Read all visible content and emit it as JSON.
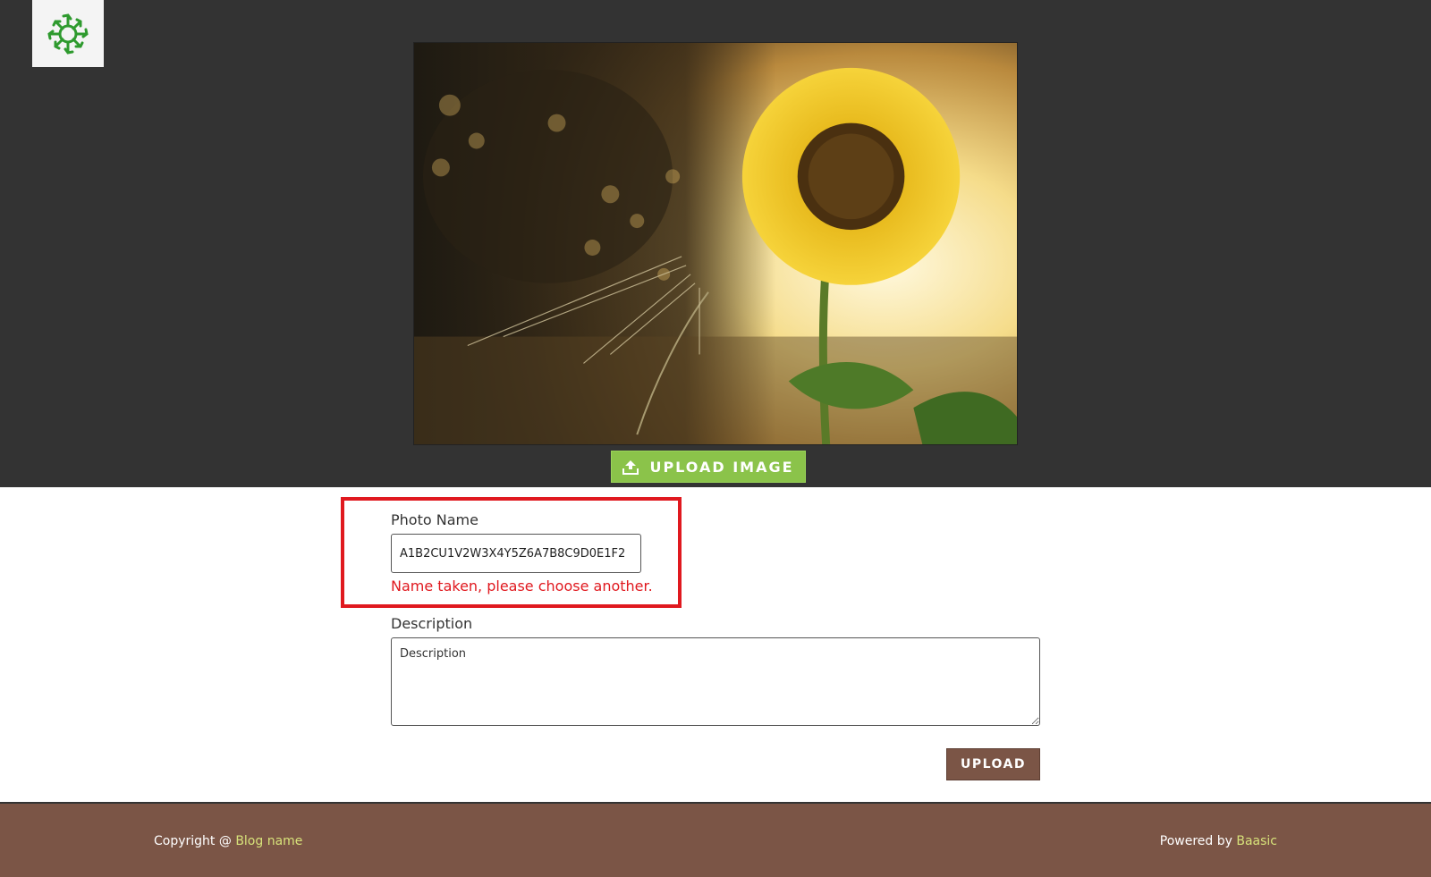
{
  "header": {
    "logo_icon": "sunburst-logo-icon",
    "hero_image": "sunflower-photo",
    "upload_image_label": "UPLOAD IMAGE",
    "upload_icon": "upload-icon"
  },
  "form": {
    "photo_name_label": "Photo Name",
    "photo_name_value": "A1B2CU1V2W3X4Y5Z6A7B8C9D0E1F2",
    "photo_name_error": "Name taken, please choose another.",
    "description_label": "Description",
    "description_placeholder": "Description",
    "upload_label": "UPLOAD"
  },
  "footer": {
    "copyright_prefix": "Copyright @ ",
    "blog_name": "Blog name",
    "powered_prefix": "Powered by ",
    "powered_link": "Baasic"
  },
  "colors": {
    "hero_bg": "#333333",
    "accent_green": "#8bc34a",
    "brown": "#7b5546",
    "error_red": "#e0191f",
    "footer_link": "#d7e27a"
  }
}
